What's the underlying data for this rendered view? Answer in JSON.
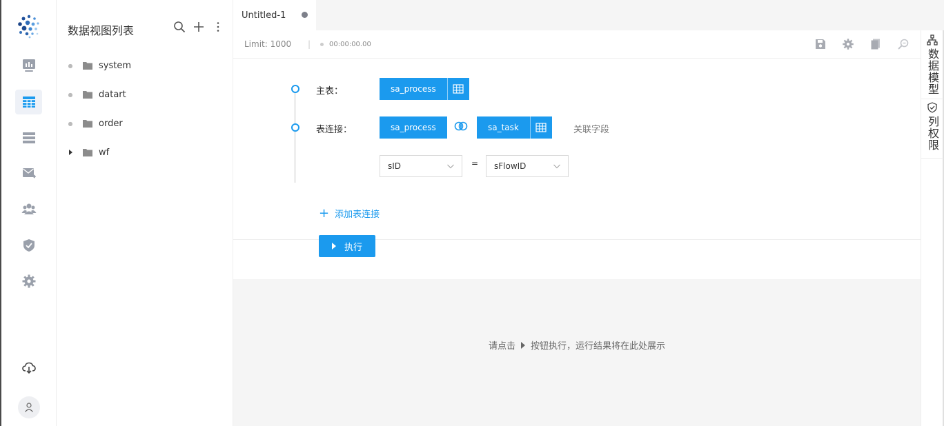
{
  "sidebar_nav": {
    "items": [
      "dashboard-icon",
      "view-icon",
      "source-icon",
      "schedule-icon",
      "members-icon",
      "permission-icon",
      "settings-icon"
    ],
    "bottom": [
      "cloud-download-icon",
      "user-avatar-icon"
    ]
  },
  "view_panel": {
    "title": "数据视图列表",
    "tools": [
      "search-icon",
      "add-icon",
      "more-icon"
    ],
    "tree": [
      {
        "label": "system",
        "expandable": false
      },
      {
        "label": "datart",
        "expandable": false
      },
      {
        "label": "order",
        "expandable": false
      },
      {
        "label": "wf",
        "expandable": true
      }
    ]
  },
  "tabs": [
    {
      "label": "Untitled-1",
      "unsaved": true
    }
  ],
  "toolbar": {
    "limit": "Limit: 1000",
    "separator": "|",
    "timer": "00:00:00.00",
    "icons": [
      "save-icon",
      "settings-icon",
      "copy-icon",
      "format-icon"
    ]
  },
  "right_tabs": [
    {
      "label": "数据模型",
      "icon": "model-icon"
    },
    {
      "label": "列权限",
      "icon": "shield-icon"
    }
  ],
  "editor": {
    "main_table_label": "主表：",
    "main_table": "sa_process",
    "join_label": "表连接：",
    "join_left": "sa_process",
    "join_right": "sa_task",
    "assoc_field_label": "关联字段",
    "left_field": "sID",
    "equals": "=",
    "right_field": "sFlowID",
    "add_join": "添加表连接",
    "run_label": "执行"
  },
  "result": {
    "hint_before": "请点击",
    "hint_after": "按钮执行，运行结果将在此处展示"
  },
  "colors": {
    "primary": "#1b9aee",
    "nav_icon": "#9aa0ab",
    "result_bg": "#f5f5f5"
  }
}
